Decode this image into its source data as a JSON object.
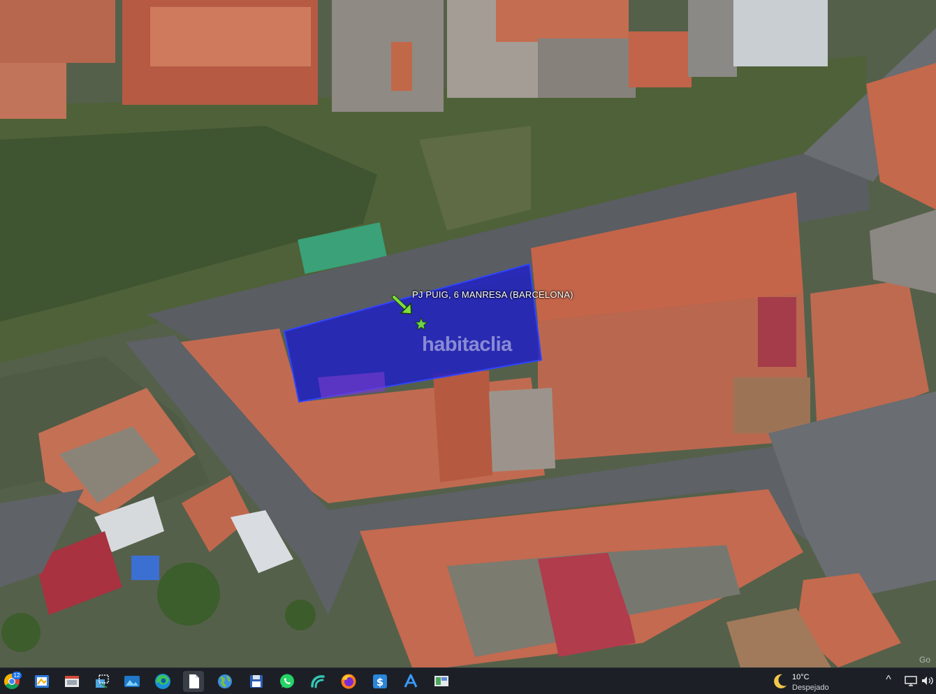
{
  "map": {
    "placemark_label": "PJ PUIG, 6  MANRESA (BARCELONA)",
    "watermark": "habitaclia",
    "attribution": "Go",
    "parcel_fill": "#1e1ec8",
    "parcel_stroke": "#2f44ff",
    "icons": [
      "placemark-arrow-icon",
      "star-icon"
    ]
  },
  "taskbar": {
    "apps": [
      {
        "name": "chrome-icon",
        "badge": "12"
      },
      {
        "name": "paint-app-icon"
      },
      {
        "name": "window-app-icon"
      },
      {
        "name": "snipping-tool-icon"
      },
      {
        "name": "photos-icon"
      },
      {
        "name": "edge-icon"
      },
      {
        "name": "file-icon"
      },
      {
        "name": "globe-icon"
      },
      {
        "name": "floppy-disk-icon"
      },
      {
        "name": "whatsapp-icon"
      },
      {
        "name": "wave-app-icon"
      },
      {
        "name": "firefox-icon"
      },
      {
        "name": "dollar-app-icon"
      },
      {
        "name": "vector-app-icon"
      },
      {
        "name": "monitor-app-icon"
      }
    ],
    "weather": {
      "temperature": "10°C",
      "condition": "Despejado",
      "icon": "moon-icon"
    },
    "tray": {
      "chevron": "^",
      "icons": [
        "network-icon",
        "speaker-icon"
      ]
    }
  }
}
